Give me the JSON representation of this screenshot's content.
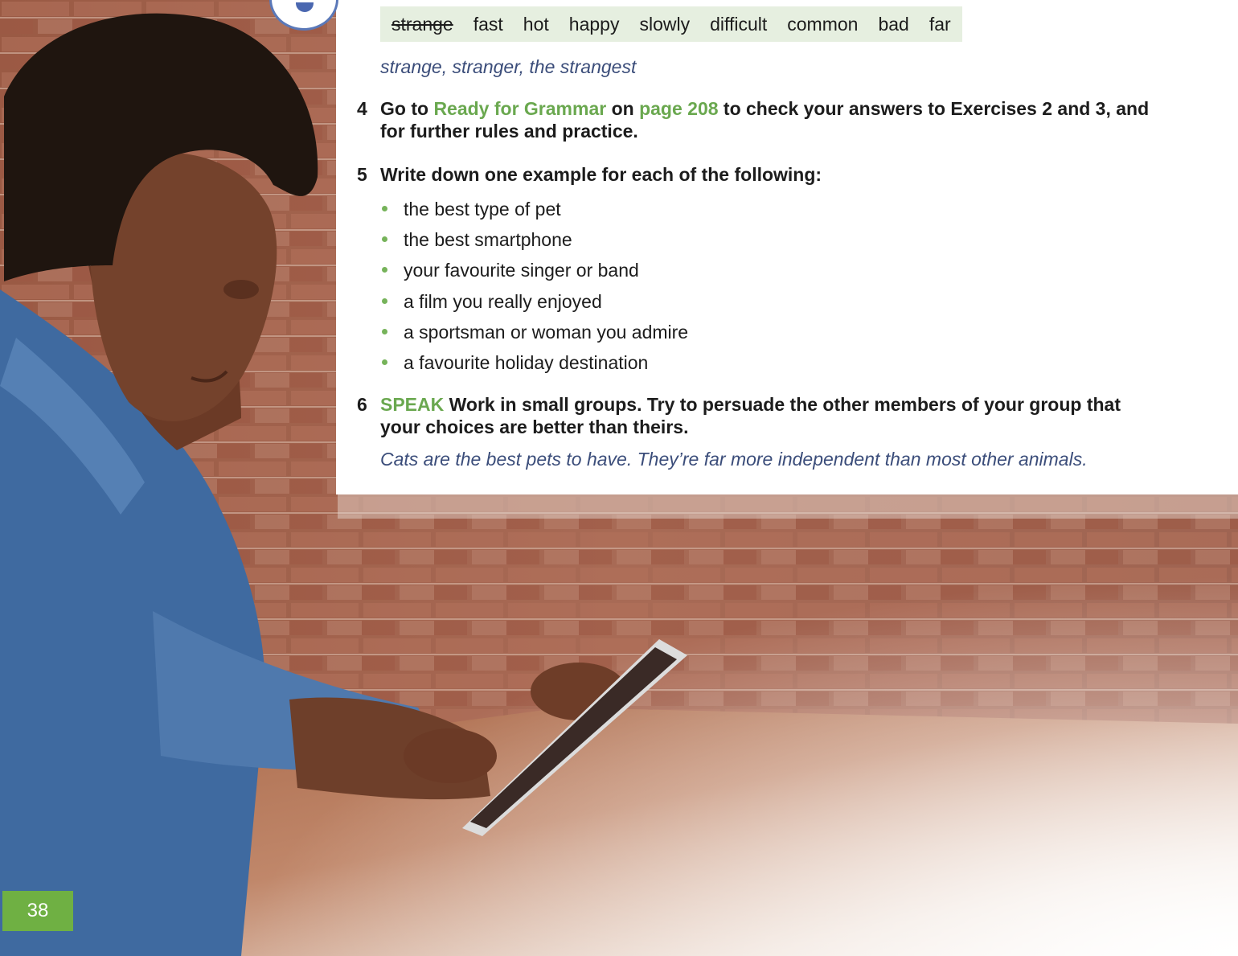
{
  "word_box": {
    "words": [
      "strange",
      "fast",
      "hot",
      "happy",
      "slowly",
      "difficult",
      "common",
      "bad",
      "far"
    ]
  },
  "example_1": "strange, stranger, the strangest",
  "exercise_4": {
    "number": "4",
    "text_a": "Go to ",
    "link_1": "Ready for Grammar",
    "text_b": " on ",
    "link_2": "page 208",
    "text_c": " to check your answers to Exercises 2 and 3, and for further rules and practice."
  },
  "exercise_5": {
    "number": "5",
    "instruction": "Write down one example for each of the following:",
    "items": [
      "the best type of pet",
      "the best smartphone",
      "your favourite singer or band",
      "a film you really enjoyed",
      "a sportsman or woman you admire",
      "a favourite holiday destination"
    ]
  },
  "exercise_6": {
    "number": "6",
    "label": "SPEAK",
    "text": " Work in small groups. Try to persuade the other members of your group that your choices are better than theirs."
  },
  "example_2": "Cats are the best pets to have. They’re far more independent than most other animals.",
  "page_number": "38",
  "colors": {
    "accent_green": "#6aa84f",
    "word_box_bg": "#e6efe0",
    "example_text": "#3b4d7a",
    "page_tab": "#6fb043"
  }
}
